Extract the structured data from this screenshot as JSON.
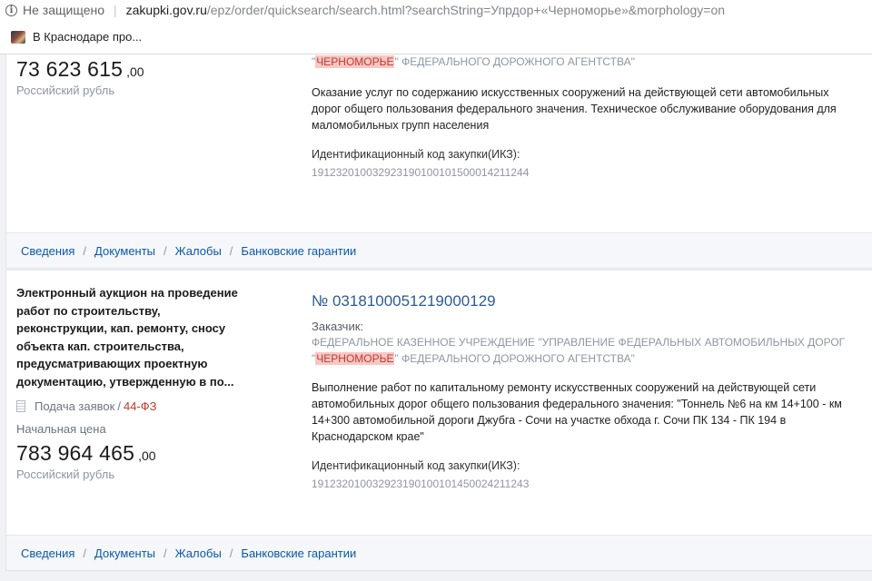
{
  "browser": {
    "security_label": "Не защищено",
    "url_host": "zakupki.gov.ru",
    "url_path": "/epz/order/quicksearch/search.html?searchString=Упрдор+«Черноморье»&morphology=on",
    "bookmark": {
      "label": "В Краснодаре про..."
    }
  },
  "cards": [
    {
      "price_int": "73 623 615",
      "price_dec": ",00",
      "currency": "Российский рубль",
      "customer_hl": "ЧЕРНОМОРЬЕ",
      "customer_line2_rest": "\" ФЕДЕРАЛЬНОГО ДОРОЖНОГО АГЕНТСТВА\"",
      "description": "Оказание услуг по содержанию искусственных сооружений на действующей сети автомобильных дорог общего пользования федерального значения. Техническое обслуживание оборудования для маломобильных групп населения",
      "ikz_label": "Идентификационный код закупки(ИКЗ):",
      "ikz_value": "191232010032923190100101500014211244",
      "footer": [
        "Сведения",
        "Документы",
        "Жалобы",
        "Банковские гарантии"
      ]
    },
    {
      "purchase_type": "Электронный аукцион на проведение работ по строительству, реконструкции, кап. ремонту, сносу объекта кап. строительства, предусматривающих проектную документацию, утвержденную в по...",
      "status": "Подача заявок",
      "law": "44-ФЗ",
      "price_label": "Начальная цена",
      "price_int": "783 964 465",
      "price_dec": ",00",
      "currency": "Российский рубль",
      "number": "№ 0318100051219000129",
      "customer_label": "Заказчик:",
      "customer_line1": "ФЕДЕРАЛЬНОЕ КАЗЕННОЕ УЧРЕЖДЕНИЕ \"УПРАВЛЕНИЕ ФЕДЕРАЛЬНЫХ АВТОМОБИЛЬНЫХ ДОРОГ",
      "customer_hl": "ЧЕРНОМОРЬЕ",
      "customer_line2_rest": "\" ФЕДЕРАЛЬНОГО ДОРОЖНОГО АГЕНТСТВА\"",
      "description": "Выполнение работ по капитальному ремонту искусственных сооружений на действующей сети автомобильных дорог общего пользования федерального значения: \"Тоннель №6 на км 14+100 - км 14+300 автомобильной дороги Джубга - Сочи на участке обхода г. Сочи ПК 134 - ПК 194 в Краснодарском крае\"",
      "ikz_label": "Идентификационный код закупки(ИКЗ):",
      "ikz_value": "191232010032923190100101450024211243",
      "footer": [
        "Сведения",
        "Документы",
        "Жалобы",
        "Банковские гарантии"
      ]
    }
  ]
}
